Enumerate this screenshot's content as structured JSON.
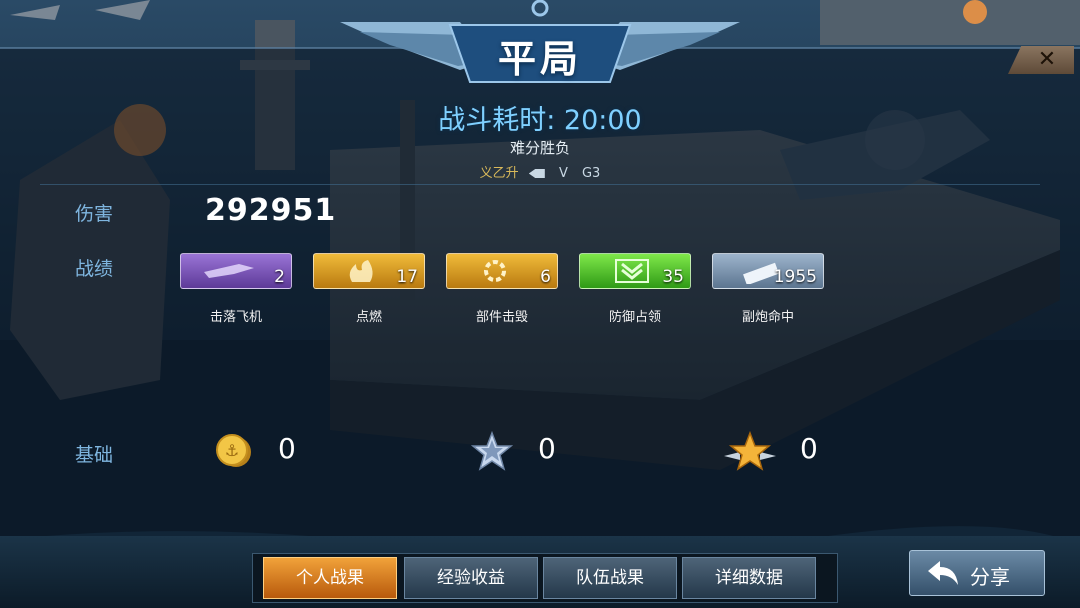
{
  "header": {
    "title": "平局",
    "close_symbol": "✕"
  },
  "battle": {
    "time_text": "战斗耗时: 20:00",
    "result_text": "难分胜负",
    "player_left": "义乙升",
    "vs": "V",
    "player_right": "G3"
  },
  "labels": {
    "damage": "伤害",
    "record": "战绩",
    "basic": "基础"
  },
  "damage_value": "292951",
  "stats": [
    {
      "label": "击落飞机",
      "value": "2",
      "color": "#7b52b8",
      "icon": "planes-icon"
    },
    {
      "label": "点燃",
      "value": "17",
      "color": "#d4991e",
      "icon": "fire-icon"
    },
    {
      "label": "部件击毁",
      "value": "6",
      "color": "#d4991e",
      "icon": "gear-broken-icon"
    },
    {
      "label": "防御占领",
      "value": "35",
      "color": "#4fbf2b",
      "icon": "chevron-shield-icon"
    },
    {
      "label": "副炮命中",
      "value": "1955",
      "color": "#6f88a6",
      "icon": "cannon-icon"
    }
  ],
  "basic": {
    "coins": "0",
    "silver_star": "0",
    "gold_star": "0"
  },
  "tabs": [
    {
      "label": "个人战果",
      "active": true
    },
    {
      "label": "经验收益",
      "active": false
    },
    {
      "label": "队伍战果",
      "active": false
    },
    {
      "label": "详细数据",
      "active": false
    }
  ],
  "share_label": "分享"
}
